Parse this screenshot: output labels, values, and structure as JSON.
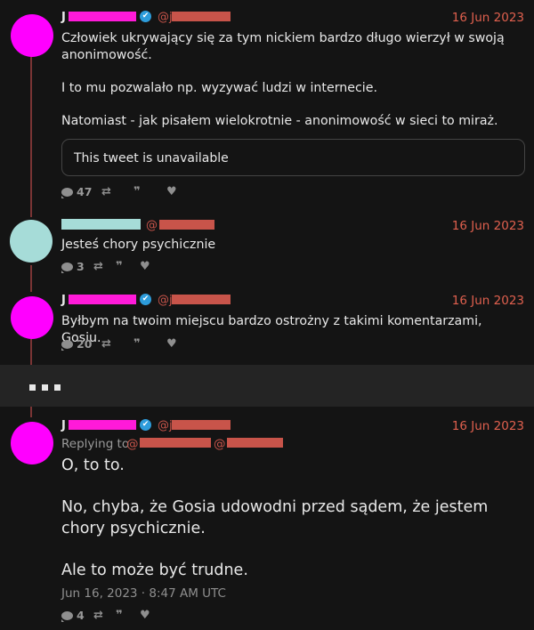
{
  "tweets": [
    {
      "name_initial": "J",
      "handle_at": "@j",
      "verified": true,
      "date": "16 Jun 2023",
      "paragraphs": [
        "Człowiek ukrywający się za tym nickiem bardzo długo wierzył w swoją anonimowość.",
        "I to mu pozwalało np. wyzywać ludzi w internecie.",
        "Natomiast - jak pisałem wielokrotnie - anonimowość w sieci to miraż."
      ],
      "quote_text": "This tweet is unavailable",
      "reply_count": "47"
    },
    {
      "name_initial": "",
      "handle_at": "@",
      "verified": false,
      "date": "16 Jun 2023",
      "paragraphs": [
        "Jesteś chory psychicznie"
      ],
      "reply_count": "3"
    },
    {
      "name_initial": "J",
      "handle_at": "@j",
      "verified": true,
      "date": "16 Jun 2023",
      "paragraphs": [
        "Byłbym na twoim miejscu bardzo ostrożny z takimi komentarzami, Gosiu."
      ],
      "reply_count": "20"
    },
    {
      "name_initial": "J",
      "handle_at": "@j",
      "verified": true,
      "date": "16 Jun 2023",
      "replying_label": "Replying to",
      "replying_at_1": "@",
      "replying_at_2": "@",
      "paragraphs": [
        "O, to to.",
        "No, chyba, że Gosia udowodni przed sądem, że jestem chory psychicznie.",
        "Ale to może być trudne."
      ],
      "timestamp": "Jun 16, 2023 · 8:47 AM UTC",
      "reply_count": "4"
    }
  ],
  "icons": {
    "comment": "comment-bubble-icon",
    "retweet": "retweet-icon",
    "quote": "quote-icon",
    "like": "heart-icon",
    "verified": "verified-badge-icon",
    "more": "more-dots-icon"
  },
  "colors": {
    "background": "#141414",
    "date": "#e0604e",
    "thread_line": "#7a3434",
    "avatar_pink": "#ff00ff",
    "avatar_mint": "#a6dcd8",
    "verified": "#2d9cdb",
    "redaction_pink": "#ff1ad9",
    "redaction_red": "#c8544a"
  }
}
